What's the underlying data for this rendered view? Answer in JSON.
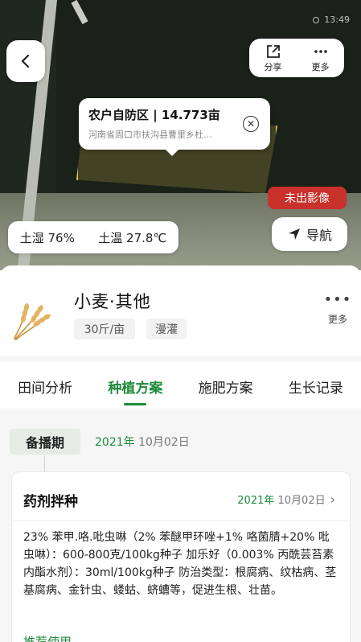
{
  "status_bar": {
    "time": "13:49"
  },
  "header": {
    "back_icon": "chevron-left-icon",
    "share_label": "分享",
    "more_label": "更多"
  },
  "plot_popup": {
    "title": "农户自防区 | 14.773亩",
    "address": "河南省周口市扶沟县曹里乡杜…"
  },
  "badge": {
    "no_image": "未出影像"
  },
  "soil": {
    "moisture": "土湿 76%",
    "temperature": "土温 27.8℃"
  },
  "nav": {
    "label": "导航"
  },
  "crop": {
    "name": "小麦·其他",
    "yield": "30斤/亩",
    "irrigation": "漫灌",
    "more_label": "更多"
  },
  "tabs": [
    {
      "label": "田间分析"
    },
    {
      "label": "种植方案"
    },
    {
      "label": "施肥方案"
    },
    {
      "label": "生长记录"
    }
  ],
  "stage": {
    "label": "备播期",
    "date_year_month": "2021年",
    "date_day": " 10月02日"
  },
  "card": {
    "title": "药剂拌种",
    "date_year": "2021年",
    "date_day": " 10月02日",
    "body": "23% 苯甲.咯.吡虫啉（2% 苯醚甲环唑+1% 咯菌腈+20% 吡虫啉）：600-800克/100kg种子 加乐好（0.003% 丙酰芸苔素内酯水剂）：30ml/100kg种子 防治类型：根腐病、纹枯病、茎基腐病、金针虫、蝼蛄、蛴螬等，促进生根、壮苗。",
    "link": "推荐使用"
  },
  "colors": {
    "accent": "#1e8a3c",
    "badge_red": "#c8312c",
    "plot_outline": "#f3c94a"
  }
}
